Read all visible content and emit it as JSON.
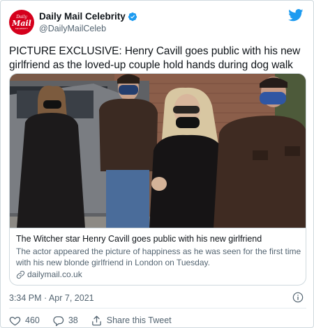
{
  "author": {
    "logo_line1": "Daily",
    "logo_line2": "Mail",
    "logo_line3": "CELEBRITY",
    "display_name": "Daily Mail Celebrity",
    "handle": "@DailyMailCeleb",
    "verified": true,
    "brand_color": "#d5001c"
  },
  "tweet": {
    "text": "PICTURE EXCLUSIVE: Henry Cavill goes public with his new girlfriend as the loved-up couple hold hands during dog walk"
  },
  "card": {
    "title": "The Witcher star Henry Cavill goes public with his new girlfriend",
    "description": "The actor appeared the picture of happiness as he was seen for the first time with his new blonde girlfriend in London on Tuesday.",
    "domain": "dailymail.co.uk"
  },
  "meta": {
    "timestamp": "3:34 PM · Apr 7, 2021"
  },
  "actions": {
    "likes": "460",
    "replies": "38",
    "share_label": "Share this Tweet"
  },
  "colors": {
    "twitter_blue": "#1d9bf0",
    "text_secondary": "#536471",
    "like_red": "#e0245e"
  },
  "icons": [
    "verified-badge-icon",
    "twitter-bird-icon",
    "link-icon",
    "info-icon",
    "heart-icon",
    "reply-icon",
    "share-icon"
  ]
}
